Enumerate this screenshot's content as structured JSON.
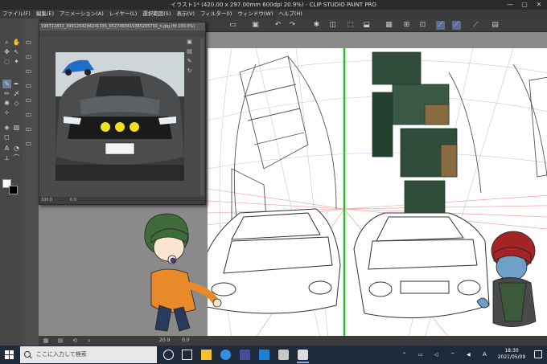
{
  "window": {
    "title": "イラスト1* (420.00 x 297.00mm 600dpi 20.9%) - CLIP STUDIO PAINT PRO",
    "minimize": "—",
    "maximize": "▢",
    "close": "✕"
  },
  "menu": [
    "ファイル(F)",
    "編集(E)",
    "アニメーション(A)",
    "レイヤー(L)",
    "選択範囲(S)",
    "表示(V)",
    "フィルター(I)",
    "ウィンドウ(W)",
    "ヘルプ(H)"
  ],
  "subwindow": {
    "title": "196712832_3991264294241335_6527490419385205792_n.jpg (fit 100.0%)",
    "zoom": "100.0",
    "angle": "0.0"
  },
  "statusbar": {
    "zoom": "20.9",
    "angle": "0.0"
  },
  "taskbar": {
    "search_placeholder": "ここに入力して検索",
    "ime": "A",
    "time": "18:30",
    "date": "2021/05/09"
  },
  "colors": {
    "accent": "#5a6f8f",
    "ruler_green": "#1ec71e",
    "perspective_red": "#e66a6a",
    "perspective_blue": "#8aa6d6"
  },
  "icons": {
    "tools": [
      "zoom-icon",
      "hand-icon",
      "move-icon",
      "select-icon",
      "lasso-icon",
      "eyedropper-icon",
      "pen-icon",
      "pencil-icon",
      "brush-icon",
      "airbrush-icon",
      "eraser-icon",
      "fill-icon",
      "gradient-icon",
      "figure-icon",
      "text-icon",
      "balloon-icon",
      "ruler-icon",
      "correct-icon"
    ]
  }
}
